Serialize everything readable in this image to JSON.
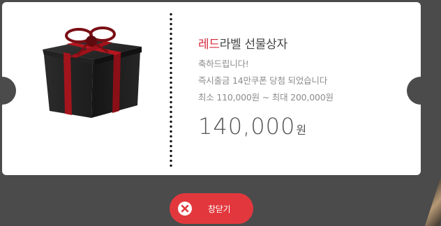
{
  "ticket": {
    "title_accent": "레드",
    "title_rest": "라벨 선물상자",
    "congrats": "축하드립니다!",
    "prize_line": "즉시출금 14만쿠폰 당첨 되었습니다",
    "range_line": "최소 110,000원 ~ 최대 200,000원",
    "amount_value": "140,000",
    "amount_unit": "원"
  },
  "close_button": {
    "label": "창닫기",
    "icon": "close-icon"
  },
  "colors": {
    "accent": "#d6283b",
    "button": "#e2383d",
    "backdrop": "#4b4b4b"
  }
}
